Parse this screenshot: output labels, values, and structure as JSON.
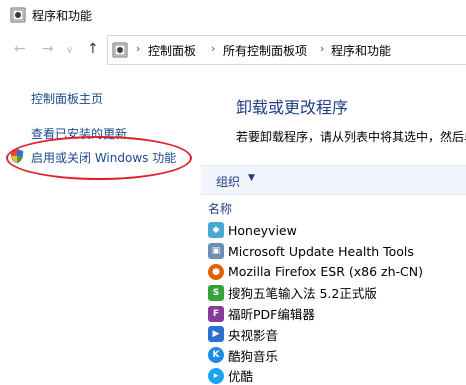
{
  "window": {
    "title": "程序和功能"
  },
  "address_bar": {
    "crumbs": [
      "控制面板",
      "所有控制面板项",
      "程序和功能"
    ]
  },
  "sidebar": {
    "links": [
      {
        "label": "控制面板主页"
      },
      {
        "label": "查看已安装的更新"
      },
      {
        "label": "启用或关闭 Windows 功能",
        "icon": "shield-icon"
      }
    ],
    "highlight_color": "#e0202a"
  },
  "main": {
    "title": "卸载或更改程序",
    "description": "若要卸载程序，请从列表中将其选中，然后单",
    "toolbar": {
      "organize_label": "组织"
    },
    "column_header": "名称",
    "programs": [
      {
        "name": "Honeyview",
        "icon": "honeyview-icon",
        "color": "#4aa8d8"
      },
      {
        "name": "Microsoft Update Health Tools",
        "icon": "installer-icon",
        "color": "#6b8fb5"
      },
      {
        "name": "Mozilla Firefox ESR (x86 zh-CN)",
        "icon": "firefox-icon",
        "color": "#e66000"
      },
      {
        "name": "搜狗五笔输入法 5.2正式版",
        "icon": "sogou-wubi-icon",
        "color": "#3aa13a"
      },
      {
        "name": "福昕PDF编辑器",
        "icon": "foxit-pdf-icon",
        "color": "#8a3a9a"
      },
      {
        "name": "央视影音",
        "icon": "cctv-icon",
        "color": "#2e6fd0"
      },
      {
        "name": "酷狗音乐",
        "icon": "kugou-icon",
        "color": "#1e8be8"
      },
      {
        "name": "优酷",
        "icon": "youku-icon",
        "color": "#1aa4f0"
      }
    ]
  },
  "colors": {
    "link": "#1a4a8a",
    "heading": "#1e3f86"
  }
}
